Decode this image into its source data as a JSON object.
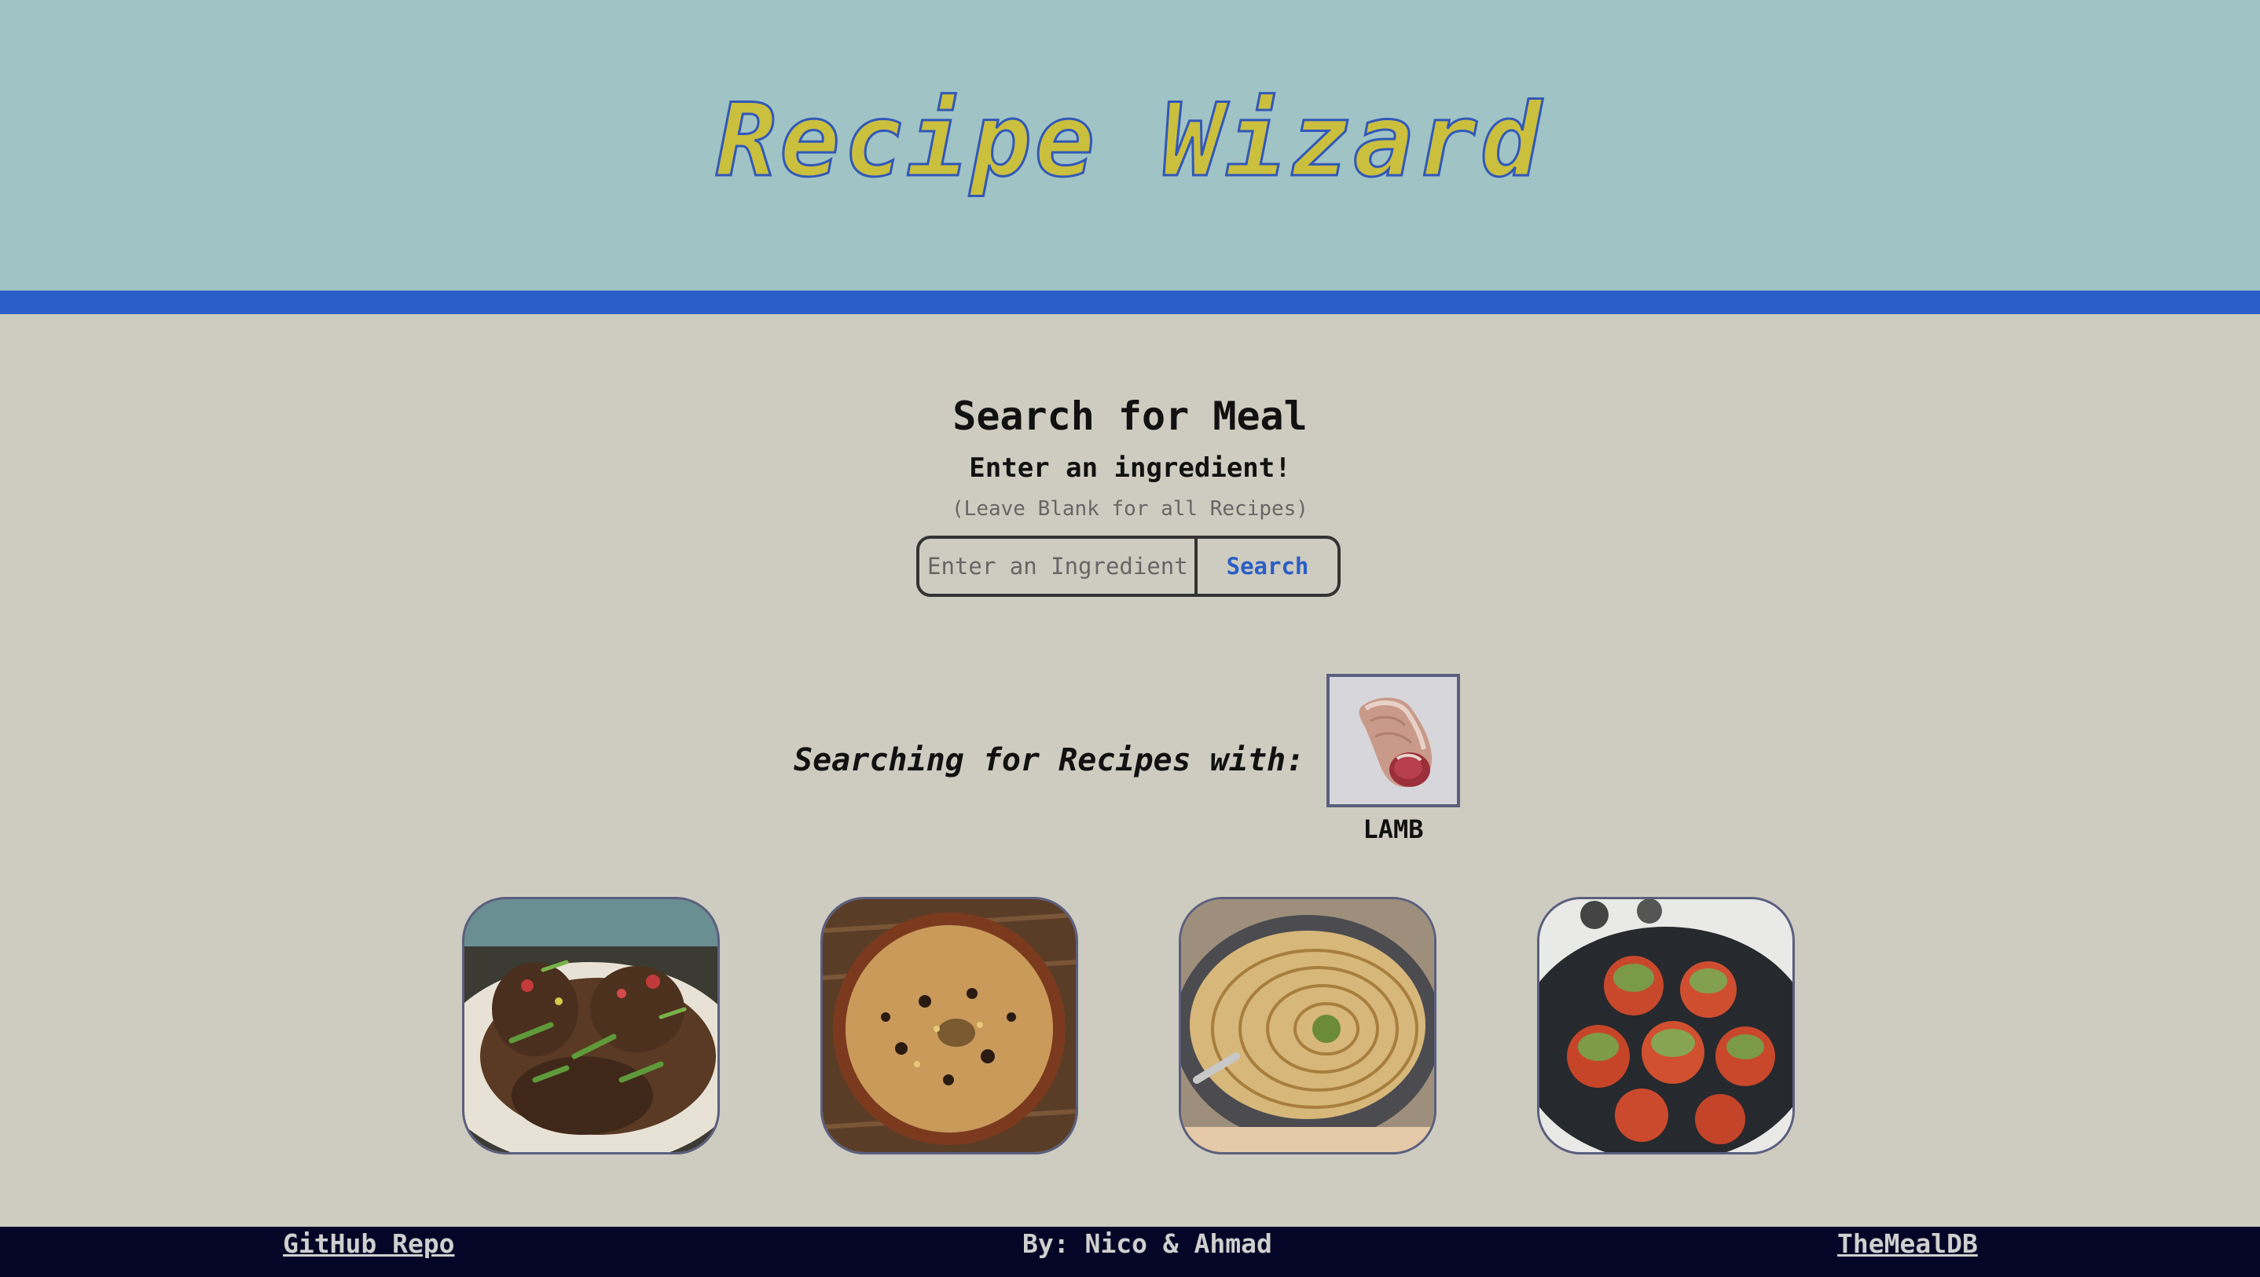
{
  "header": {
    "title": "Recipe Wizard"
  },
  "search": {
    "heading": "Search for Meal",
    "subheading": "Enter an ingredient!",
    "hint": "(Leave Blank for all Recipes)",
    "input_placeholder": "Enter an Ingredient",
    "input_value": "",
    "button_label": "Search"
  },
  "results": {
    "searching_label": "Searching for Recipes with:",
    "ingredient": {
      "name": "LAMB",
      "icon": "lamb-meat-image"
    },
    "recipes": [
      {
        "image": "braised-lamb-shanks-image"
      },
      {
        "image": "lamb-pilaf-rice-image"
      },
      {
        "image": "lamb-potato-hotpot-image"
      },
      {
        "image": "stuffed-tomatoes-image"
      }
    ]
  },
  "footer": {
    "left_link": "GitHub Repo",
    "credit": "By: Nico & Ahmad",
    "right_link": "TheMealDB"
  },
  "colors": {
    "header_bg": "#a0c3c5",
    "accent_blue": "#2b5ec6",
    "title_yellow": "#cbbf3e",
    "page_bg": "#ceccc0",
    "footer_bg": "#050527"
  }
}
